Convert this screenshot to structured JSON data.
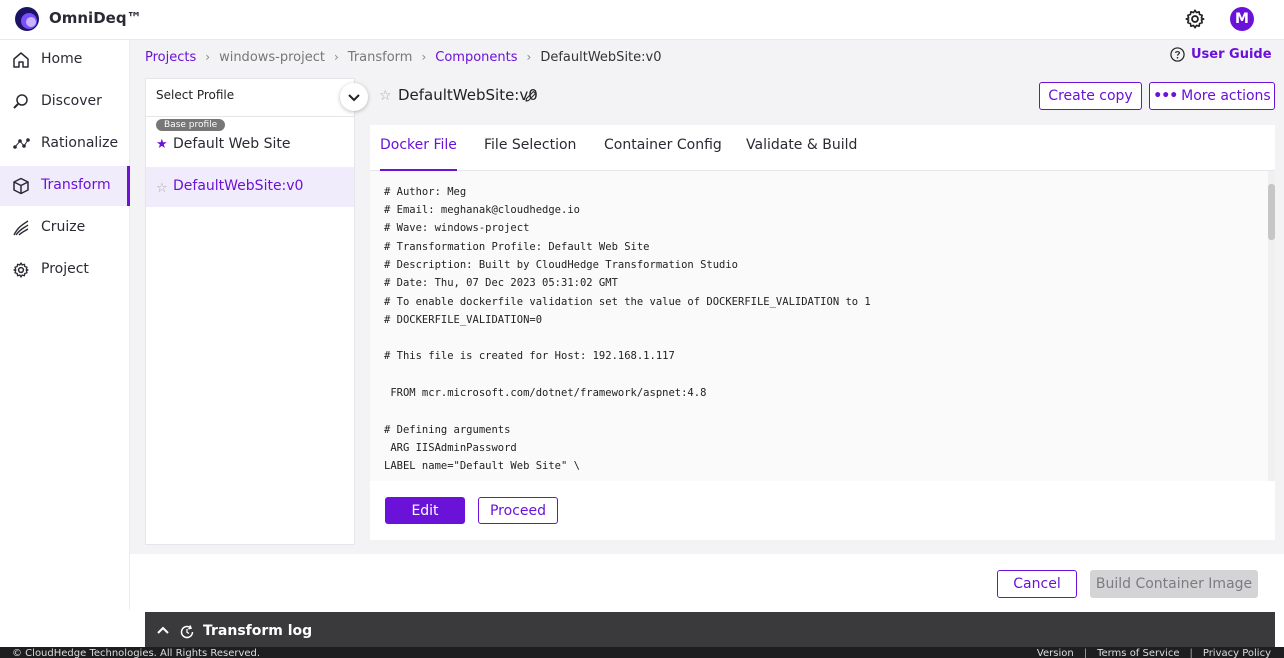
{
  "app": {
    "name": "OmniDeq™",
    "user_initial": "M"
  },
  "sidebar": {
    "items": [
      {
        "label": "Home",
        "icon": "home-icon"
      },
      {
        "label": "Discover",
        "icon": "discover-icon"
      },
      {
        "label": "Rationalize",
        "icon": "rationalize-icon"
      },
      {
        "label": "Transform",
        "icon": "transform-icon",
        "active": true
      },
      {
        "label": "Cruize",
        "icon": "cruize-icon"
      },
      {
        "label": "Project",
        "icon": "project-icon"
      }
    ]
  },
  "breadcrumb": {
    "items": [
      "Projects",
      "windows-project",
      "Transform",
      "Components",
      "DefaultWebSite:v0"
    ]
  },
  "header": {
    "user_guide": "User Guide"
  },
  "profiles": {
    "select_label": "Select Profile",
    "base_badge": "Base profile",
    "items": [
      {
        "name": "Default Web Site",
        "starred": true
      },
      {
        "name": "DefaultWebSite:v0",
        "starred": false,
        "selected": true
      }
    ]
  },
  "component": {
    "title": "DefaultWebSite:v0",
    "create_copy": "Create copy",
    "more_actions": "More actions"
  },
  "tabs": [
    "Docker File",
    "File Selection",
    "Container Config",
    "Validate & Build"
  ],
  "dockerfile": {
    "lines": [
      "# Author: Meg",
      "# Email: meghanak@cloudhedge.io",
      "# Wave: windows-project",
      "# Transformation Profile: Default Web Site",
      "# Description: Built by CloudHedge Transformation Studio",
      "# Date: Thu, 07 Dec 2023 05:31:02 GMT",
      "# To enable dockerfile validation set the value of DOCKERFILE_VALIDATION to 1",
      "# DOCKERFILE_VALIDATION=0",
      "",
      "# This file is created for Host: 192.168.1.117",
      "",
      " FROM mcr.microsoft.com/dotnet/framework/aspnet:4.8",
      "",
      "# Defining arguments",
      " ARG IISAdminPassword",
      "LABEL name=\"Default Web Site\" \\"
    ]
  },
  "editor_actions": {
    "edit": "Edit",
    "proceed": "Proceed"
  },
  "actions": {
    "cancel": "Cancel",
    "build": "Build Container Image"
  },
  "log": {
    "label": "Transform log"
  },
  "footer": {
    "copyright": "© CloudHedge Technologies. All Rights Reserved.",
    "links": [
      "Version",
      "Terms of Service",
      "Privacy Policy"
    ]
  },
  "colors": {
    "accent": "#6b12d8",
    "log_bg": "#3a3a3c",
    "disabled": "#d4d4d6"
  }
}
